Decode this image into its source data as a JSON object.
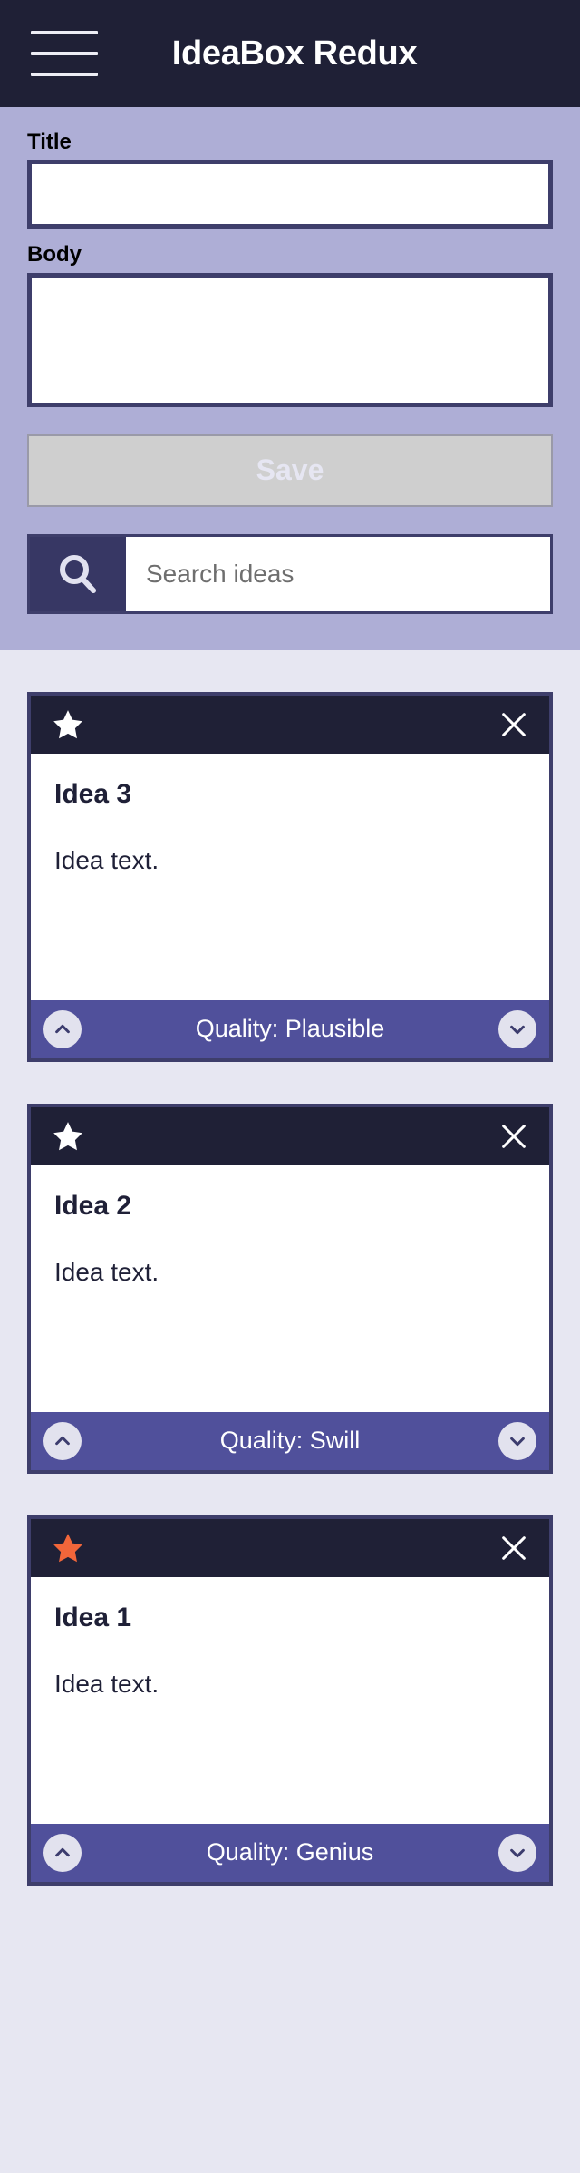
{
  "header": {
    "title": "IdeaBox Redux",
    "menu_icon": "hamburger-menu-icon"
  },
  "form": {
    "title_label": "Title",
    "title_value": "",
    "title_placeholder": "",
    "body_label": "Body",
    "body_value": "",
    "body_placeholder": "",
    "save_label": "Save",
    "save_disabled": true,
    "search_icon": "magnifying-glass-icon",
    "search_value": "",
    "search_placeholder": "Search ideas"
  },
  "colors": {
    "header_bg": "#1F2036",
    "form_bg": "#AEAED6",
    "page_bg": "#E7E7F2",
    "card_border": "#3E3E6B",
    "card_top_bg": "#1F2036",
    "card_footer_bg": "#50509B",
    "star_active": "#F2663A",
    "star_inactive": "#FFFFFF",
    "save_disabled_bg": "#CFCFCF",
    "save_disabled_text": "#E6E6F2",
    "search_icon_bg": "#373764"
  },
  "ideas": [
    {
      "title": "Idea 3",
      "body": "Idea text.",
      "starred": false,
      "star_icon": "star-icon",
      "close_icon": "close-icon",
      "quality_label": "Quality: Plausible",
      "up_icon": "chevron-up-icon",
      "down_icon": "chevron-down-icon"
    },
    {
      "title": "Idea 2",
      "body": "Idea text.",
      "starred": false,
      "star_icon": "star-icon",
      "close_icon": "close-icon",
      "quality_label": "Quality: Swill",
      "up_icon": "chevron-up-icon",
      "down_icon": "chevron-down-icon"
    },
    {
      "title": "Idea 1",
      "body": "Idea text.",
      "starred": true,
      "star_icon": "star-icon",
      "close_icon": "close-icon",
      "quality_label": "Quality: Genius",
      "up_icon": "chevron-up-icon",
      "down_icon": "chevron-down-icon"
    }
  ]
}
